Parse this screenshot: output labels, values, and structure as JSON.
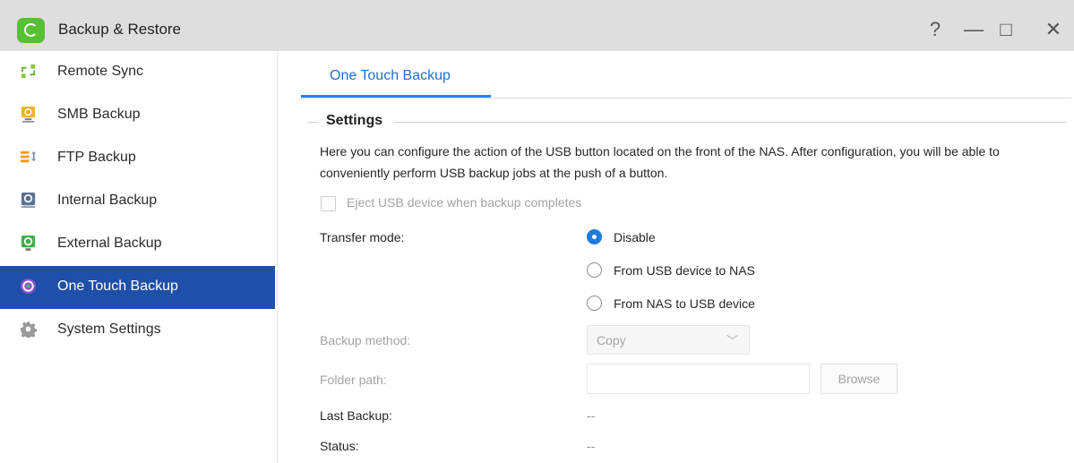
{
  "window": {
    "title": "Backup & Restore",
    "help_symbol": "?",
    "minimize_symbol": "—",
    "maximize_symbol": "□",
    "close_symbol": "✕"
  },
  "sidebar": {
    "items": [
      {
        "label": "Remote Sync",
        "icon": "remote-sync-icon",
        "color": "#63b537"
      },
      {
        "label": "SMB Backup",
        "icon": "smb-backup-icon",
        "color": "#f0b323"
      },
      {
        "label": "FTP Backup",
        "icon": "ftp-backup-icon",
        "color": "#f09a1c"
      },
      {
        "label": "Internal Backup",
        "icon": "internal-backup-icon",
        "color": "#5a7191"
      },
      {
        "label": "External Backup",
        "icon": "external-backup-icon",
        "color": "#44ad4b"
      },
      {
        "label": "One Touch Backup",
        "icon": "one-touch-backup-icon",
        "color": "#8d4fd1",
        "active": true
      },
      {
        "label": "System Settings",
        "icon": "gear-icon",
        "color": "#9a9a9a"
      }
    ]
  },
  "main": {
    "tab_label": "One Touch Backup",
    "section_title": "Settings",
    "description": "Here you can configure the action of the USB button located on the front of the NAS. After configuration, you will be able to conveniently perform USB backup jobs at the push of a button.",
    "eject_checkbox_label": "Eject USB device when backup completes",
    "transfer_mode_label": "Transfer mode:",
    "transfer_options": [
      {
        "label": "Disable",
        "checked": true
      },
      {
        "label": "From USB device to NAS",
        "checked": false
      },
      {
        "label": "From NAS to USB device",
        "checked": false
      }
    ],
    "backup_method_label": "Backup method:",
    "backup_method_value": "Copy",
    "folder_path_label": "Folder path:",
    "folder_path_value": "",
    "browse_label": "Browse",
    "last_backup_label": "Last Backup:",
    "last_backup_value": "--",
    "status_label": "Status:",
    "status_value": "--"
  },
  "colors": {
    "accent": "#1f7ae0",
    "sidebar_active": "#1e4fa9",
    "titlebar": "#dedede",
    "app_icon": "#58c034"
  }
}
